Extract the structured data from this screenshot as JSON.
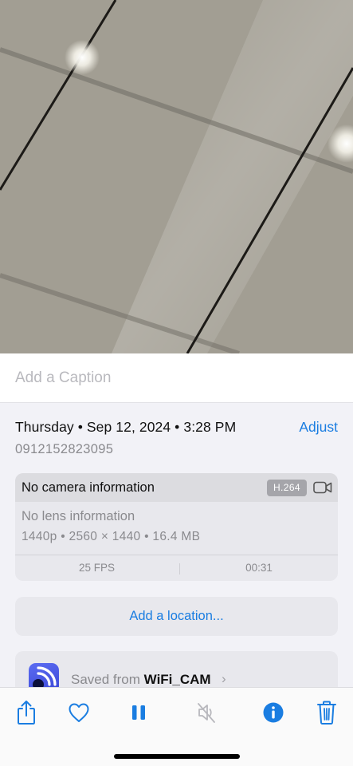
{
  "media": {
    "description_icon": "video-frame-icon"
  },
  "caption": {
    "placeholder": "Add a Caption"
  },
  "details": {
    "date_line": "Thursday • Sep 12, 2024 • 3:28 PM",
    "adjust_label": "Adjust",
    "serial": "0912152823095"
  },
  "info": {
    "camera": "No camera information",
    "codec": "H.264",
    "lens": "No lens information",
    "specs": "1440p • 2560 × 1440 • 16.4 MB",
    "fps": "25 FPS",
    "duration": "00:31",
    "icon": "video-camera-icon"
  },
  "location": {
    "label": "Add a location..."
  },
  "saved": {
    "prefix": "Saved from",
    "app": "WiFi_CAM",
    "chevron": "›",
    "icon": "wifi-app-icon"
  },
  "toolbar": {
    "items": [
      {
        "name": "share",
        "icon": "share-icon"
      },
      {
        "name": "favorite",
        "icon": "heart-icon"
      },
      {
        "name": "pause",
        "icon": "pause-icon"
      },
      {
        "name": "mute",
        "icon": "speaker-muted-icon"
      },
      {
        "name": "info",
        "icon": "info-icon"
      },
      {
        "name": "delete",
        "icon": "trash-icon"
      }
    ]
  },
  "colors": {
    "accent": "#1a7de1",
    "background": "#f2f2f7"
  }
}
